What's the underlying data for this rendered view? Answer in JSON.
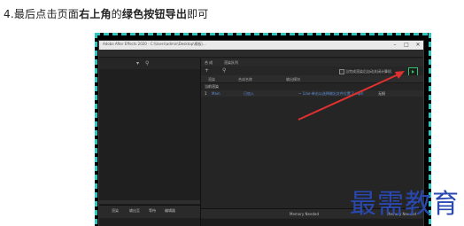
{
  "instruction": {
    "step_prefix": "4.最后点击页面",
    "bold1": "右上角",
    "mid": "的",
    "bold2": "绿色按钮导出",
    "suffix": "即可"
  },
  "screenshot": {
    "title_bar": "Adobe After Effects 2020 - C:\\Users\\admin\\Desktop\\模板\\...",
    "render_queue": {
      "tabs": [
        "合 成",
        "渲染队列"
      ],
      "toolbar_checkbox_label": "当完成渲染后自动关闭计算机",
      "render_button_icon": "play-icon",
      "headers": [
        "渲染",
        "#",
        "合成名称",
        "状态",
        "输出模块",
        "输出到"
      ],
      "row_group": "当前渲染",
      "row": {
        "index": "1",
        "comp": "Main",
        "status": "已加入",
        "output_module": "无损",
        "output_to": "~ 1/ae-单击以选择输出文件位置 2.mp4"
      },
      "footer": [
        "Memory Needed",
        "Memory Needed"
      ]
    },
    "left_panel_footer": [
      "渲染",
      "输出至",
      "等待",
      "编辑器"
    ]
  },
  "annotation": {
    "arrow_color": "#e03030"
  },
  "watermark": "最需教育"
}
